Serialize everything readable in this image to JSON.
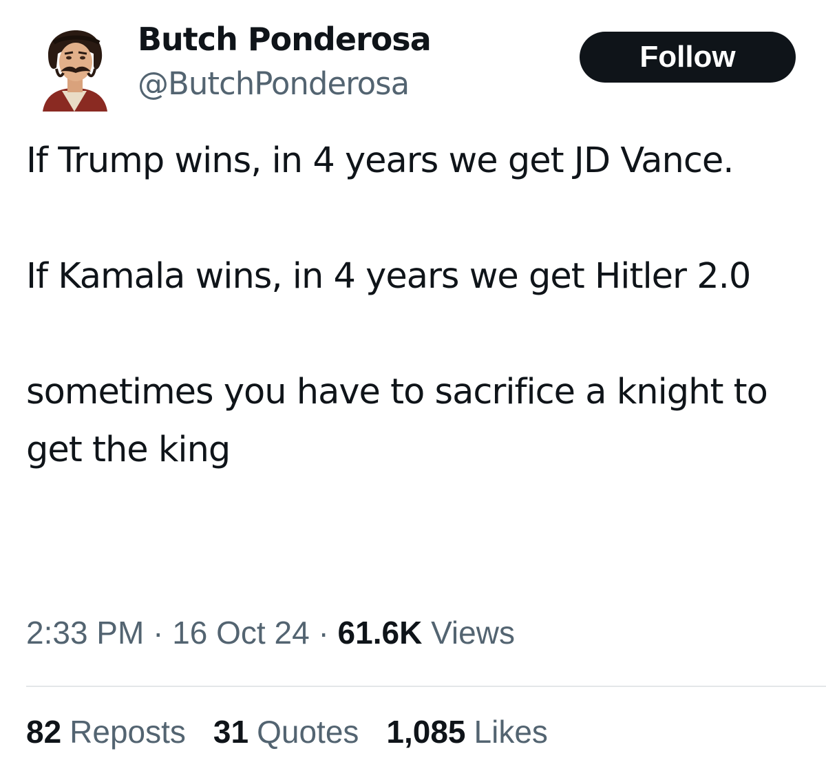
{
  "author": {
    "display_name": "Butch Ponderosa",
    "handle": "@ButchPonderosa",
    "avatar": "portrait-avatar"
  },
  "follow_label": "Follow",
  "tweet": {
    "paragraphs": [
      "If Trump wins, in 4 years we get JD Vance.",
      "If Kamala wins, in 4 years we get Hitler 2.0",
      "sometimes you have to sacrifice a knight to get the king"
    ]
  },
  "meta": {
    "time": "2:33 PM",
    "separator": "·",
    "date": "16 Oct 24",
    "views_count": "61.6K",
    "views_label": "Views"
  },
  "engagement": {
    "reposts_count": "82",
    "reposts_label": "Reposts",
    "quotes_count": "31",
    "quotes_label": "Quotes",
    "likes_count": "1,085",
    "likes_label": "Likes"
  },
  "colors": {
    "text": "#0f1419",
    "secondary_text": "#536471",
    "button_bg": "#0f1419",
    "divider": "#e3e6e8"
  }
}
